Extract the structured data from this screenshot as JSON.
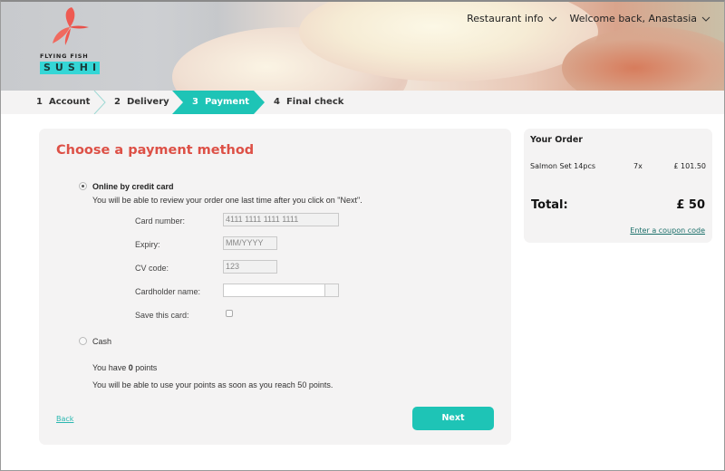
{
  "brand": {
    "line1": "FLYING FISH",
    "line2": "SUSHI",
    "accent_color": "#34d6d6",
    "fish_color": "#ee5a52"
  },
  "topnav": {
    "restaurant_info": "Restaurant info",
    "welcome": "Welcome back, Anastasia"
  },
  "steps": [
    {
      "num": "1",
      "label": "Account"
    },
    {
      "num": "2",
      "label": "Delivery"
    },
    {
      "num": "3",
      "label": "Payment",
      "active": true
    },
    {
      "num": "4",
      "label": "Final check"
    }
  ],
  "payment": {
    "title": "Choose a payment method",
    "online": {
      "label": "Online by credit card",
      "selected": true,
      "note": "You will be able to review your order one last time after you click on \"Next\".",
      "card_number_label": "Card number:",
      "card_number_value": "4111 1111 1111 1111",
      "expiry_label": "Expiry:",
      "expiry_placeholder": "MM/YYYY",
      "cv_label": "CV code:",
      "cv_value": "123",
      "cardholder_label": "Cardholder name:",
      "cardholder_value": "",
      "save_card_label": "Save this card:",
      "save_card_checked": false
    },
    "cash": {
      "label": "Cash",
      "selected": false
    },
    "points": {
      "prefix": "You have",
      "value": "0",
      "suffix": "points",
      "note": "You will be able to use your points as soon as you reach 50 points."
    },
    "back_label": "Back",
    "next_label": "Next",
    "primary_color": "#1ec4b6",
    "title_color": "#dd5046"
  },
  "order": {
    "title": "Your Order",
    "items": [
      {
        "name": "Salmon Set  14pcs",
        "qty": "7x",
        "price": "£ 101.50"
      }
    ],
    "total_label": "Total:",
    "total_value": "£ 50",
    "coupon_label": "Enter a coupon code"
  }
}
